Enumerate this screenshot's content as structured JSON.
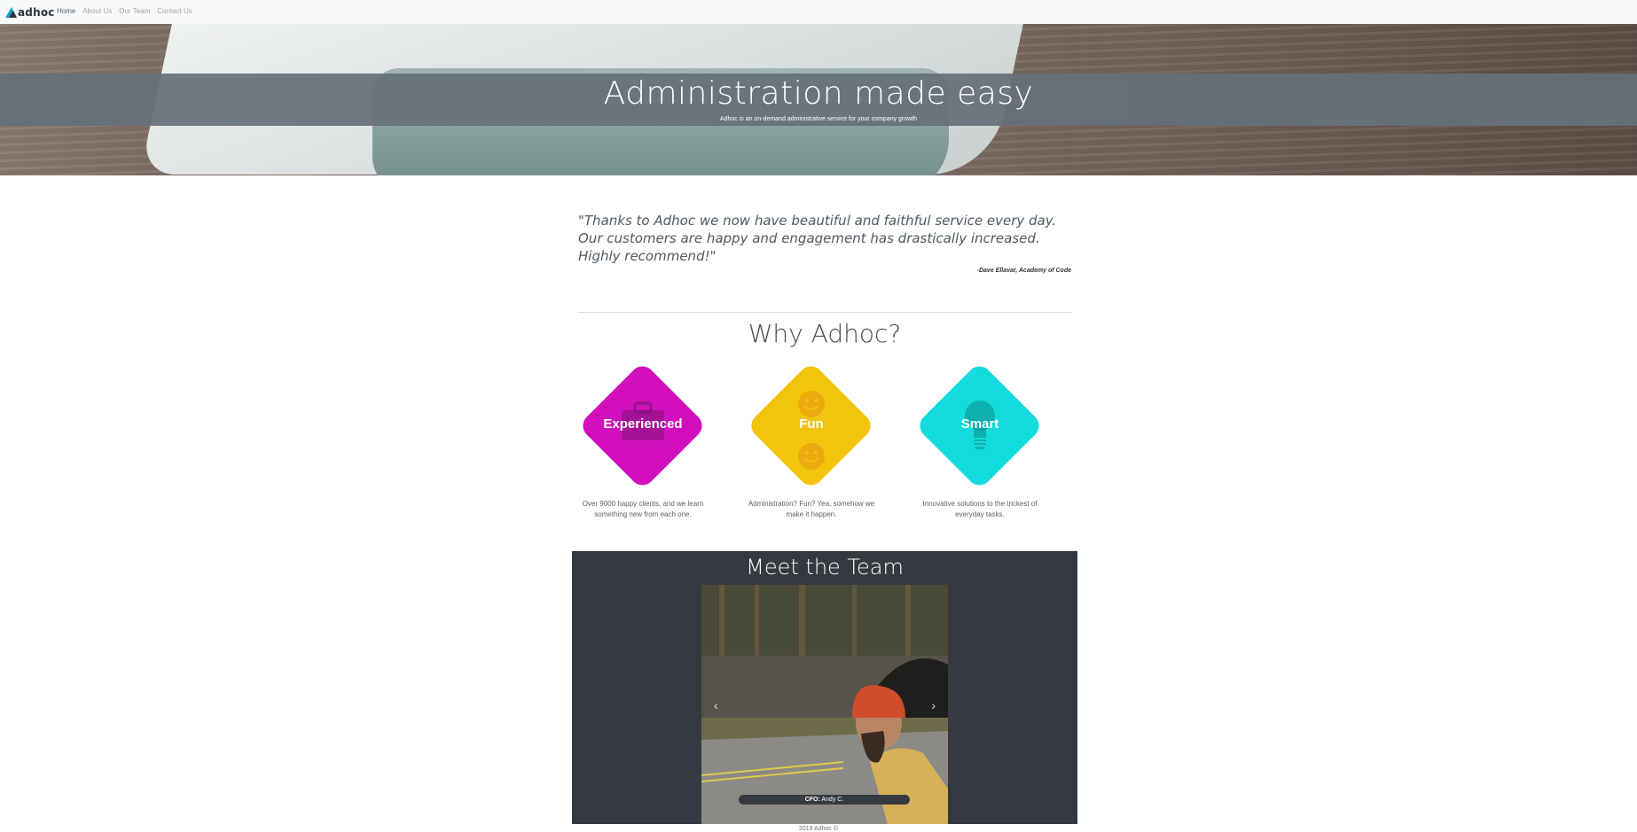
{
  "nav": {
    "brand": "adhoc",
    "links": [
      "Home",
      "About Us",
      "Our Team",
      "Contact Us"
    ]
  },
  "hero": {
    "title": "Administration made easy",
    "subtitle": "Adhoc is an on-demand administrative service for your company growth"
  },
  "testimonial": {
    "quote": "\"Thanks to Adhoc we now have beautiful and faithful service every day. Our customers are happy and engagement has drastically increased. Highly recommend!\"",
    "author": "-Dave Ellavar, Academy of Code"
  },
  "why": {
    "title": "Why Adhoc?",
    "features": [
      {
        "label": "Experienced",
        "description": "Over 9000 happy clients, and we learn something new from each one.",
        "color": "#d10fbd",
        "icon": "briefcase-icon"
      },
      {
        "label": "Fun",
        "description": "Administration? Fun? Yea, somehow we make it happen.",
        "color": "#f2c40c",
        "icon": "smiley-icon"
      },
      {
        "label": "Smart",
        "description": "Innovative solutions to the trickest of everyday tasks.",
        "color": "#14dcdc",
        "icon": "lightbulb-icon"
      }
    ]
  },
  "team": {
    "title": "Meet the Team",
    "caption_role": "CFO:",
    "caption_name": " Andy C.",
    "prev_icon": "chevron-left-icon",
    "next_icon": "chevron-right-icon"
  },
  "footer": {
    "text": "2019 Adhoc ©"
  }
}
